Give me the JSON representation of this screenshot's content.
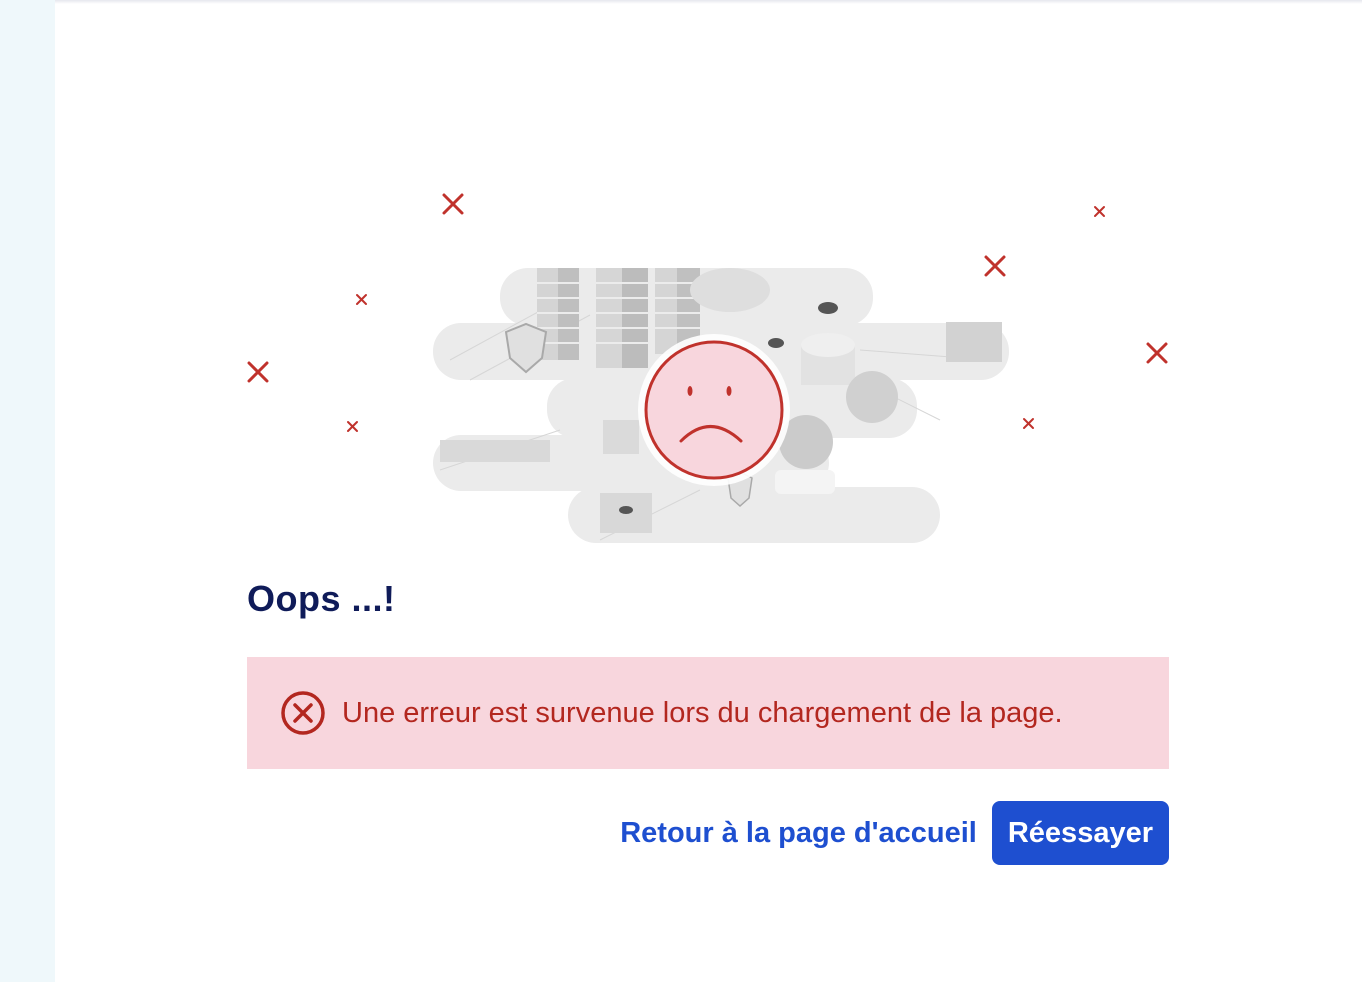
{
  "error_page": {
    "title": "Oops ...!",
    "alert": {
      "icon": "error-circle-icon",
      "message": "Une erreur est survenue lors du chargement de la page."
    },
    "actions": {
      "home_link_label": "Retour à la page d'accueil",
      "retry_label": "Réessayer"
    },
    "illustration": {
      "icon": "sad-face-icon",
      "decorations": "x-mark-icon"
    }
  },
  "colors": {
    "title": "#0f1b59",
    "accent": "#1e4fd0",
    "error_text": "#b3271f",
    "error_background": "#f8d6dd",
    "sidebar_background": "#eff8fb"
  }
}
